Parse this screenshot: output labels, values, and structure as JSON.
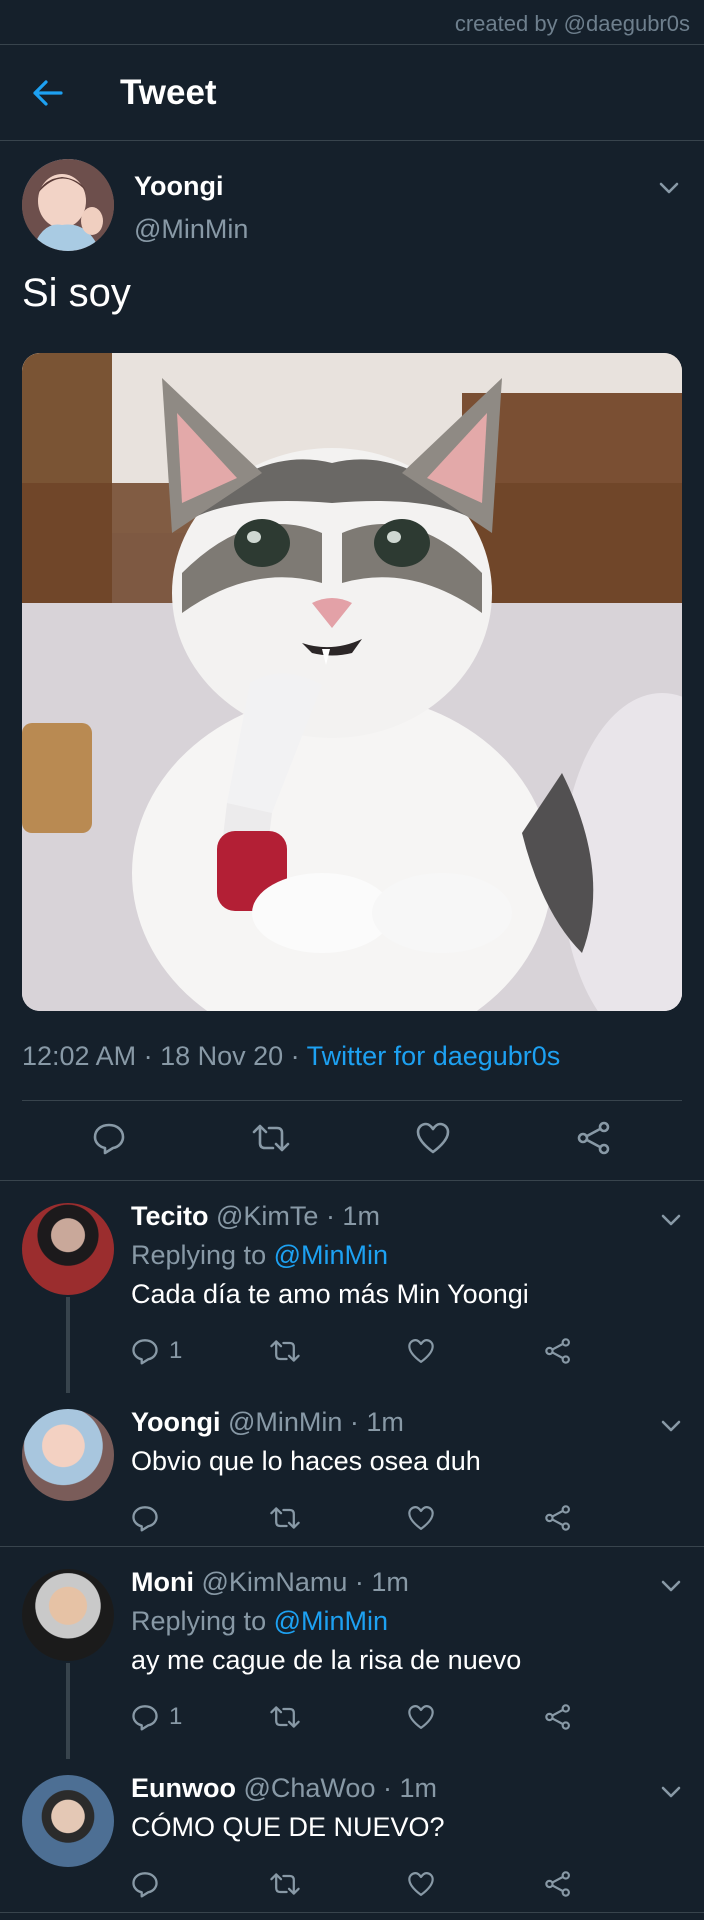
{
  "watermark": "created by @daegubr0s",
  "header": {
    "title": "Tweet"
  },
  "tweet": {
    "name": "Yoongi",
    "handle": "@MinMin",
    "text": "Si soy",
    "time": "12:02 AM · 18 Nov 20 · ",
    "source": "Twitter for daegubr0s"
  },
  "replies": [
    {
      "name": "Tecito",
      "meta": " @KimTe · 1m",
      "replying_prefix": "Replying to ",
      "replying_to": "@MinMin",
      "text": "Cada día te amo más Min Yoongi",
      "reply_count": "1"
    },
    {
      "name": "Yoongi",
      "meta": " @MinMin · 1m",
      "text": "Obvio que lo haces osea duh",
      "reply_count": ""
    },
    {
      "name": "Moni",
      "meta": " @KimNamu · 1m",
      "replying_prefix": "Replying to ",
      "replying_to": "@MinMin",
      "text": "ay me cague de la risa de nuevo",
      "reply_count": "1"
    },
    {
      "name": "Eunwoo",
      "meta": " @ChaWoo · 1m",
      "text": "CÓMO QUE DE  NUEVO?",
      "reply_count": ""
    }
  ],
  "colors": {
    "background": "#15202b",
    "accent": "#1da1f2",
    "muted": "#8899a6",
    "divider": "#38444d"
  }
}
